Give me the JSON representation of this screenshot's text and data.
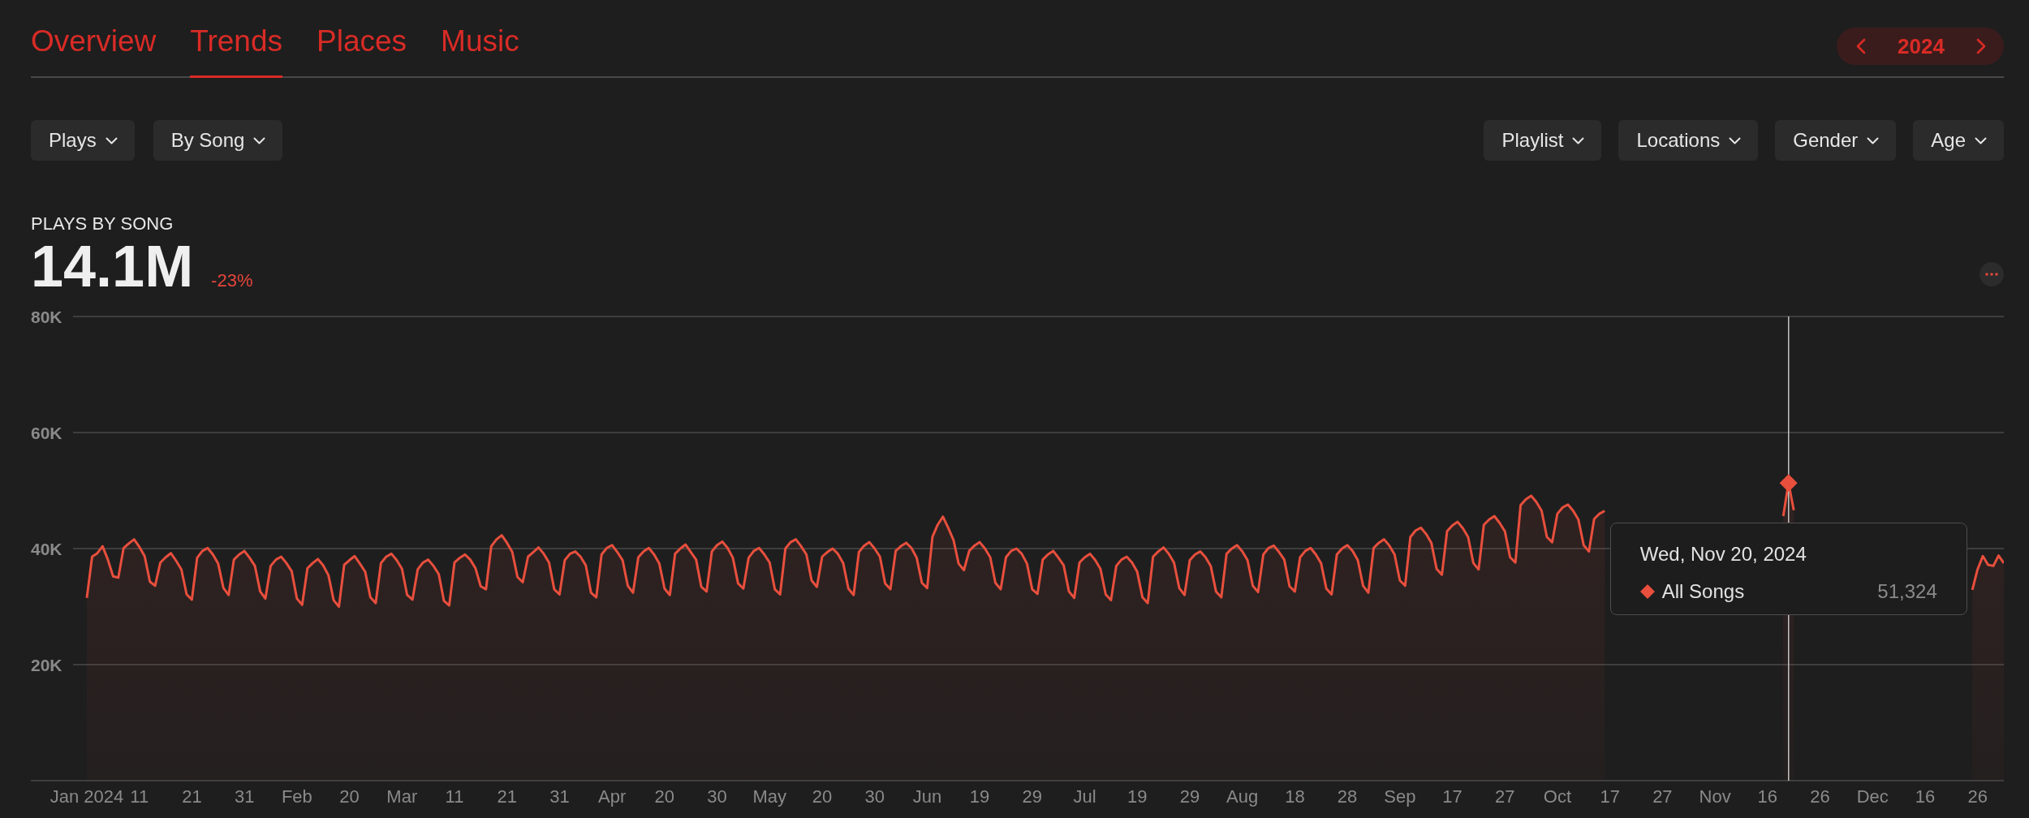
{
  "tabs": [
    {
      "label": "Overview",
      "selected": false
    },
    {
      "label": "Trends",
      "selected": true
    },
    {
      "label": "Places",
      "selected": false
    },
    {
      "label": "Music",
      "selected": false
    }
  ],
  "year_selector": {
    "year": "2024"
  },
  "filters_left": [
    {
      "label": "Plays"
    },
    {
      "label": "By Song"
    }
  ],
  "filters_right": [
    {
      "label": "Playlist"
    },
    {
      "label": "Locations"
    },
    {
      "label": "Gender"
    },
    {
      "label": "Age"
    }
  ],
  "metric": {
    "title": "PLAYS BY SONG",
    "value": "14.1M",
    "change": "-23%",
    "change_negative": true
  },
  "chart_data": {
    "type": "area",
    "grid": true,
    "categories": [
      "Jan 2024",
      null,
      null,
      null,
      null,
      null,
      null,
      null,
      null,
      null,
      "11",
      null,
      null,
      null,
      null,
      null,
      null,
      null,
      null,
      null,
      "21",
      null,
      null,
      null,
      null,
      null,
      null,
      null,
      null,
      null,
      "31",
      null,
      null,
      null,
      null,
      null,
      null,
      null,
      null,
      null,
      "Feb",
      null,
      null,
      null,
      null,
      null,
      null,
      null,
      null,
      null,
      "20",
      null,
      null,
      null,
      null,
      null,
      null,
      null,
      null,
      null,
      "Mar",
      null,
      null,
      null,
      null,
      null,
      null,
      null,
      null,
      null,
      "11",
      null,
      null,
      null,
      null,
      null,
      null,
      null,
      null,
      null,
      "21",
      null,
      null,
      null,
      null,
      null,
      null,
      null,
      null,
      null,
      "31",
      null,
      null,
      null,
      null,
      null,
      null,
      null,
      null,
      null,
      "Apr",
      null,
      null,
      null,
      null,
      null,
      null,
      null,
      null,
      null,
      "20",
      null,
      null,
      null,
      null,
      null,
      null,
      null,
      null,
      null,
      "30",
      null,
      null,
      null,
      null,
      null,
      null,
      null,
      null,
      null,
      "May",
      null,
      null,
      null,
      null,
      null,
      null,
      null,
      null,
      null,
      "20",
      null,
      null,
      null,
      null,
      null,
      null,
      null,
      null,
      null,
      "30",
      null,
      null,
      null,
      null,
      null,
      null,
      null,
      null,
      null,
      "Jun",
      null,
      null,
      null,
      null,
      null,
      null,
      null,
      null,
      null,
      "19",
      null,
      null,
      null,
      null,
      null,
      null,
      null,
      null,
      null,
      "29",
      null,
      null,
      null,
      null,
      null,
      null,
      null,
      null,
      null,
      "Jul",
      null,
      null,
      null,
      null,
      null,
      null,
      null,
      null,
      null,
      "19",
      null,
      null,
      null,
      null,
      null,
      null,
      null,
      null,
      null,
      "29",
      null,
      null,
      null,
      null,
      null,
      null,
      null,
      null,
      null,
      "Aug",
      null,
      null,
      null,
      null,
      null,
      null,
      null,
      null,
      null,
      "18",
      null,
      null,
      null,
      null,
      null,
      null,
      null,
      null,
      null,
      "28",
      null,
      null,
      null,
      null,
      null,
      null,
      null,
      null,
      null,
      "Sep",
      null,
      null,
      null,
      null,
      null,
      null,
      null,
      null,
      null,
      "17",
      null,
      null,
      null,
      null,
      null,
      null,
      null,
      null,
      null,
      "27",
      null,
      null,
      null,
      null,
      null,
      null,
      null,
      null,
      null,
      "Oct",
      null,
      null,
      null,
      null,
      null,
      null,
      null,
      null,
      null,
      "17",
      null,
      null,
      null,
      null,
      null,
      null,
      null,
      null,
      null,
      "27",
      null,
      null,
      null,
      null,
      null,
      null,
      null,
      null,
      null,
      "Nov",
      null,
      null,
      null,
      null,
      null,
      null,
      null,
      null,
      null,
      "16",
      null,
      null,
      null,
      null,
      null,
      null,
      null,
      null,
      null,
      "26",
      null,
      null,
      null,
      null,
      null,
      null,
      null,
      null,
      null,
      "Dec",
      null,
      null,
      null,
      null,
      null,
      null,
      null,
      null,
      null,
      "16",
      null,
      null,
      null,
      null,
      null,
      null,
      null,
      null,
      null,
      "26",
      null,
      null,
      null,
      null,
      null
    ],
    "ylim": [
      0,
      80
    ],
    "yticks": [
      {
        "value": 20,
        "label": "20K"
      },
      {
        "value": 40,
        "label": "40K"
      },
      {
        "value": 60,
        "label": "60K"
      },
      {
        "value": 80,
        "label": "80K"
      }
    ],
    "series": [
      {
        "name": "All Songs",
        "color": "#e84f3d",
        "values": [
          31.5,
          38.6,
          39.2,
          40.4,
          38.1,
          35.2,
          35.0,
          40.1,
          40.9,
          41.6,
          40.3,
          38.7,
          34.3,
          33.6,
          37.6,
          38.5,
          39.2,
          37.9,
          36.4,
          32.1,
          31.2,
          38.4,
          39.6,
          40.1,
          39.0,
          37.4,
          33.2,
          32.0,
          38.1,
          39.0,
          39.6,
          38.4,
          37.0,
          32.6,
          31.4,
          37.0,
          38.1,
          38.6,
          37.5,
          36.1,
          31.4,
          30.3,
          36.6,
          37.5,
          38.2,
          37.1,
          35.4,
          31.1,
          30.0,
          37.2,
          38.0,
          38.7,
          37.4,
          36.0,
          31.6,
          30.6,
          37.5,
          38.6,
          39.1,
          38.0,
          36.5,
          32.0,
          31.2,
          36.4,
          37.6,
          38.1,
          37.0,
          35.6,
          31.0,
          30.2,
          37.6,
          38.4,
          39.0,
          38.1,
          36.6,
          33.5,
          33.0,
          40.4,
          41.6,
          42.3,
          41.0,
          39.4,
          35.1,
          34.2,
          38.6,
          39.4,
          40.2,
          39.1,
          37.6,
          33.0,
          32.1,
          38.0,
          39.1,
          39.5,
          38.6,
          37.1,
          32.4,
          31.6,
          39.0,
          40.1,
          40.6,
          39.4,
          38.0,
          33.6,
          32.4,
          38.5,
          39.5,
          40.1,
          39.0,
          37.4,
          33.1,
          32.0,
          39.1,
          40.0,
          40.7,
          39.4,
          38.1,
          33.4,
          32.6,
          39.5,
          40.6,
          41.2,
          40.1,
          38.4,
          34.0,
          33.1,
          38.4,
          39.6,
          40.1,
          39.0,
          37.6,
          33.0,
          32.1,
          40.0,
          41.1,
          41.6,
          40.4,
          39.0,
          34.5,
          33.4,
          38.6,
          39.4,
          40.0,
          39.1,
          37.5,
          33.1,
          32.0,
          39.4,
          40.5,
          41.1,
          40.0,
          38.6,
          34.0,
          33.0,
          39.6,
          40.4,
          41.0,
          40.1,
          38.4,
          34.1,
          33.2,
          42.0,
          44.1,
          45.5,
          43.6,
          41.5,
          37.4,
          36.3,
          39.6,
          40.5,
          41.1,
          40.0,
          38.5,
          34.1,
          33.0,
          38.5,
          39.6,
          40.0,
          39.1,
          37.4,
          33.0,
          32.2,
          38.1,
          39.0,
          39.6,
          38.4,
          37.1,
          32.6,
          31.5,
          37.6,
          38.5,
          39.1,
          38.0,
          36.5,
          32.1,
          31.1,
          37.0,
          38.1,
          38.6,
          37.6,
          36.0,
          31.6,
          30.6,
          38.6,
          39.5,
          40.2,
          39.1,
          37.6,
          33.2,
          32.0,
          38.0,
          39.0,
          39.5,
          38.5,
          37.0,
          32.6,
          31.6,
          39.1,
          40.0,
          40.6,
          39.5,
          38.0,
          33.6,
          32.5,
          39.0,
          40.1,
          40.5,
          39.4,
          38.1,
          33.5,
          32.6,
          38.5,
          39.6,
          40.1,
          39.0,
          37.5,
          33.1,
          32.1,
          39.0,
          40.0,
          40.6,
          39.6,
          38.0,
          33.6,
          32.4,
          40.1,
          41.0,
          41.6,
          40.5,
          39.0,
          34.5,
          33.6,
          42.0,
          43.1,
          43.6,
          42.5,
          41.0,
          36.5,
          35.5,
          43.0,
          44.0,
          44.6,
          43.5,
          42.0,
          37.5,
          36.4,
          44.1,
          45.0,
          45.6,
          44.4,
          43.0,
          38.5,
          37.6,
          47.5,
          48.5,
          49.1,
          48.0,
          46.5,
          42.0,
          41.1,
          46.0,
          47.1,
          47.6,
          46.5,
          45.0,
          40.6,
          39.5,
          45.1,
          46.0,
          46.5,
          null,
          null,
          null,
          null,
          null,
          null,
          null,
          null,
          null,
          null,
          null,
          null,
          null,
          null,
          null,
          null,
          null,
          null,
          null,
          null,
          null,
          null,
          null,
          null,
          null,
          null,
          null,
          null,
          null,
          null,
          null,
          null,
          null,
          45.6,
          51.3,
          46.6,
          null,
          null,
          null,
          null,
          null,
          null,
          null,
          null,
          null,
          null,
          null,
          null,
          null,
          null,
          null,
          null,
          null,
          null,
          null,
          null,
          null,
          null,
          null,
          null,
          null,
          null,
          null,
          null,
          null,
          null,
          null,
          null,
          null,
          32.9,
          36.4,
          38.7,
          37.2,
          37.0,
          38.8,
          37.5
        ]
      }
    ]
  },
  "crosshair": {
    "level": 0.8909
  },
  "tooltip": {
    "date": "Wed, Nov 20, 2024",
    "values": [
      "51,324"
    ]
  }
}
